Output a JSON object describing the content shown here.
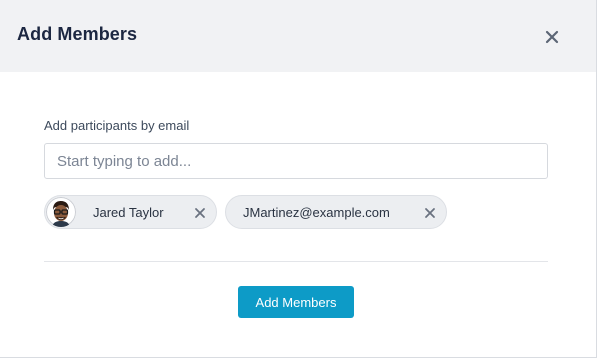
{
  "dialog": {
    "title": "Add Members",
    "close_icon": "close-icon"
  },
  "form": {
    "label": "Add participants by email",
    "input_value": "",
    "input_placeholder": "Start typing to add..."
  },
  "participants": [
    {
      "name": "Jared Taylor",
      "has_avatar": true,
      "remove_icon": "close-icon"
    },
    {
      "name": "JMartinez@example.com",
      "has_avatar": false,
      "remove_icon": "close-icon"
    }
  ],
  "footer": {
    "submit_label": "Add Members"
  },
  "colors": {
    "header_bg": "#f1f2f4",
    "title_text": "#1c2741",
    "chip_bg": "#eceef1",
    "primary_button": "#0d9bc7"
  }
}
